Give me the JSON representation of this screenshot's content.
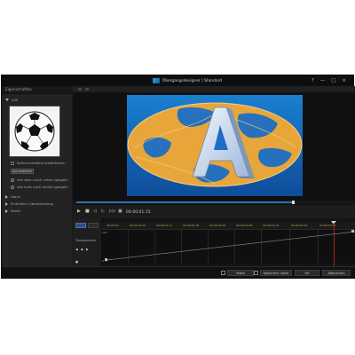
{
  "window": {
    "title": "Übergangsdesigner | Standard",
    "controls": [
      "?",
      "—",
      "□",
      "×"
    ]
  },
  "left_panel": {
    "header": "Eigenschaften",
    "section_maske": "Alle",
    "checkbox_label": "Seitenverhältnis beibehalten",
    "button_label": "Aktualisieren",
    "option1": "Von oben nach unten spiegeln",
    "option2": "Von links nach rechts spiegeln",
    "section_glanz": "Glanz",
    "section_effect": "Einheitlich Überblendung",
    "section_kante": "Kante"
  },
  "transport": {
    "timecode": "00:00:01:15"
  },
  "timeline": {
    "ticks": [
      "00:00:00",
      "00:00:01:04",
      "00:00:01:11",
      "00:00:01:18",
      "00:00:02:00",
      "00:00:02:08",
      "00:00:02:15",
      "00:00:02:22",
      "00:00:03:00"
    ],
    "track_label": "Transparenz",
    "axis_top": "100",
    "axis_bottom": "0 %"
  },
  "bottom_bar": {
    "save": "Teilen",
    "save_as": "Speichern unter",
    "ok": "OK",
    "cancel": "Abbrechen"
  },
  "colors": {
    "accent": "#2f6db5",
    "playhead": "#b02020",
    "tick": "#c9a640"
  }
}
